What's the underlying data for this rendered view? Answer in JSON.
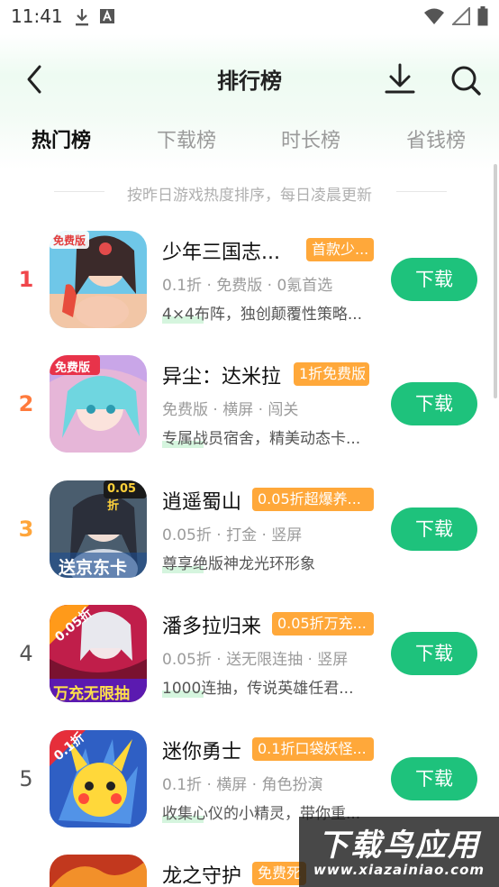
{
  "status_bar": {
    "time": "11:41"
  },
  "header": {
    "title": "排行榜"
  },
  "tabs": [
    {
      "label": "热门榜",
      "active": true
    },
    {
      "label": "下载榜",
      "active": false
    },
    {
      "label": "时长榜",
      "active": false
    },
    {
      "label": "省钱榜",
      "active": false
    }
  ],
  "subtitle": "按昨日游戏热度排序，每日凌晨更新",
  "games": [
    {
      "rank": "1",
      "rank_color": "#f0464b",
      "name": "少年三国志...",
      "tag": "首款少...",
      "meta": "0.1折 · 免费版 · 0氪首选",
      "desc": "4×4布阵，独创颠覆性策略...",
      "button": "下载",
      "icon_badge": "免费版"
    },
    {
      "rank": "2",
      "rank_color": "#ff7a3c",
      "name": "异尘：达米拉",
      "tag": "1折免费版",
      "meta": "免费版 · 横屏 · 闯关",
      "desc": "专属战员宿舍，精美动态卡...",
      "button": "下载",
      "icon_badge": "免费版"
    },
    {
      "rank": "3",
      "rank_color": "#ffa53a",
      "name": "逍遥蜀山",
      "tag": "0.05折超爆养...",
      "meta": "0.05折 · 打金 · 竖屏",
      "desc": "尊享绝版神龙光环形象",
      "button": "下载",
      "icon_badge": "0.05折",
      "icon_caption": "送京东卡"
    },
    {
      "rank": "4",
      "rank_color": "#555555",
      "name": "潘多拉归来",
      "tag": "0.05折万充...",
      "meta": "0.05折 · 送无限连抽 · 竖屏",
      "desc": "1000连抽，传说英雄任君...",
      "button": "下载",
      "icon_badge": "0.05折",
      "icon_caption": "万充无限抽"
    },
    {
      "rank": "5",
      "rank_color": "#555555",
      "name": "迷你勇士",
      "tag": "0.1折口袋妖怪...",
      "meta": "0.1折 · 横屏 · 角色扮演",
      "desc": "收集心仪的小精灵，带你重...",
      "button": "下载",
      "icon_badge": "0.1折"
    },
    {
      "rank": "",
      "rank_color": "#555555",
      "name": "龙之守护",
      "tag": "免费死",
      "meta": "",
      "desc": "",
      "button": "",
      "icon_badge": ""
    }
  ],
  "watermark": {
    "big": "下载鸟应用",
    "small": "www.xiazainiao.com"
  }
}
